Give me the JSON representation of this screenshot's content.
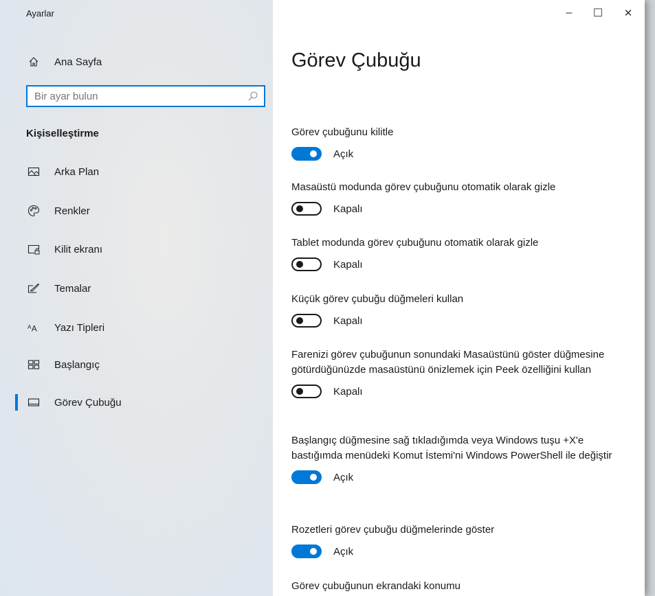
{
  "app": {
    "title": "Ayarlar"
  },
  "window_controls": {
    "minimize": "–",
    "maximize": "☐",
    "close": "✕"
  },
  "sidebar": {
    "home_label": "Ana Sayfa",
    "search_placeholder": "Bir ayar bulun",
    "section": "Kişiselleştirme",
    "items": [
      {
        "label": "Arka Plan",
        "icon": "picture-icon"
      },
      {
        "label": "Renkler",
        "icon": "palette-icon"
      },
      {
        "label": "Kilit ekranı",
        "icon": "lock-screen-icon"
      },
      {
        "label": "Temalar",
        "icon": "themes-icon"
      },
      {
        "label": "Yazı Tipleri",
        "icon": "fonts-icon"
      },
      {
        "label": "Başlangıç",
        "icon": "start-icon"
      },
      {
        "label": "Görev Çubuğu",
        "icon": "taskbar-icon",
        "active": true
      }
    ]
  },
  "main": {
    "title": "Görev Çubuğu",
    "settings": [
      {
        "label": "Görev çubuğunu kilitle",
        "state": "Açık",
        "on": true
      },
      {
        "label": "Masaüstü modunda görev çubuğunu otomatik olarak gizle",
        "state": "Kapalı",
        "on": false
      },
      {
        "label": "Tablet modunda görev çubuğunu otomatik olarak gizle",
        "state": "Kapalı",
        "on": false
      },
      {
        "label": "Küçük görev çubuğu düğmeleri kullan",
        "state": "Kapalı",
        "on": false
      },
      {
        "label": "Farenizi görev çubuğunun sonundaki Masaüstünü göster düğmesine götürdüğünüzde masaüstünü önizlemek için Peek özelliğini kullan",
        "state": "Kapalı",
        "on": false
      },
      {
        "label": "Başlangıç düğmesine sağ tıkladığımda veya Windows tuşu +X'e bastığımda menüdeki Komut İstemi'ni Windows PowerShell ile değiştir",
        "state": "Açık",
        "on": true
      },
      {
        "label": "Rozetleri görev çubuğu düğmelerinde göster",
        "state": "Açık",
        "on": true
      }
    ],
    "position_label": "Görev çubuğunun ekrandaki konumu"
  },
  "colors": {
    "accent": "#0078d7"
  }
}
